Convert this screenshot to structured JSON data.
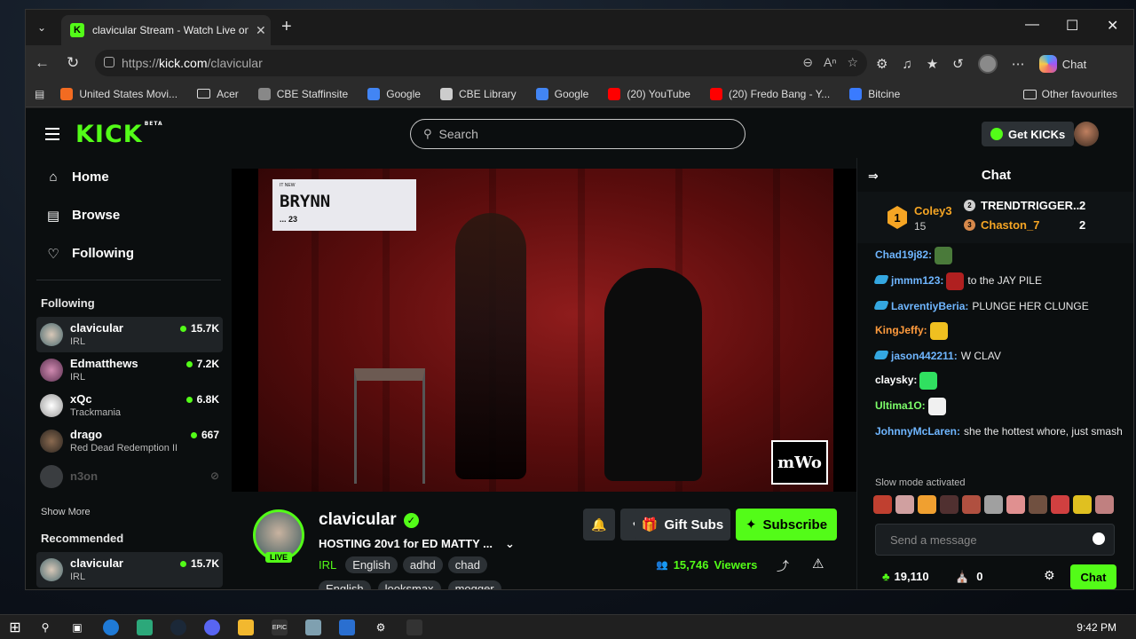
{
  "browser": {
    "tab_title": "clavicular Stream - Watch Live on",
    "url_scheme": "https://",
    "url_host": "kick.com",
    "url_path": "/clavicular",
    "copilot_label": "Chat",
    "bookmarks": [
      {
        "label": "United States Movi...",
        "color": "#f26b21"
      },
      {
        "label": "Acer",
        "color": "folder"
      },
      {
        "label": "CBE Staffinsite",
        "color": "#888888"
      },
      {
        "label": "Google",
        "color": "#4285f4"
      },
      {
        "label": "CBE Library",
        "color": "#cccccc"
      },
      {
        "label": "Google",
        "color": "#4285f4"
      },
      {
        "label": "(20) YouTube",
        "color": "#ff0000"
      },
      {
        "label": "(20) Fredo Bang - Y...",
        "color": "#ff0000"
      },
      {
        "label": "Bitcine",
        "color": "#3a7bff"
      }
    ],
    "other_favourites": "Other favourites"
  },
  "kick": {
    "logo": "KICK",
    "logo_sup": "BETA",
    "search_placeholder": "Search",
    "get_kicks": "Get KICKs",
    "accent": "#53fc18"
  },
  "sidebar": {
    "nav": [
      {
        "label": "Home",
        "icon": "home-icon"
      },
      {
        "label": "Browse",
        "icon": "browse-icon"
      },
      {
        "label": "Following",
        "icon": "heart-icon"
      }
    ],
    "following_title": "Following",
    "following": [
      {
        "name": "clavicular",
        "category": "IRL",
        "viewers": "15.7K"
      },
      {
        "name": "Edmatthews",
        "category": "IRL",
        "viewers": "7.2K"
      },
      {
        "name": "xQc",
        "category": "Trackmania",
        "viewers": "6.8K"
      },
      {
        "name": "drago",
        "category": "Red Dead Redemption II",
        "viewers": "667"
      }
    ],
    "offline_channel": "n3on",
    "show_more": "Show More",
    "recommended_title": "Recommended",
    "recommended": [
      {
        "name": "clavicular",
        "category": "IRL",
        "viewers": "15.7K"
      }
    ]
  },
  "video": {
    "name_card_small": "IT NEW",
    "name_card_name": "BRYNN",
    "name_card_age": "... 23",
    "watermark": "mWo"
  },
  "stream": {
    "streamer": "clavicular",
    "live_label": "LIVE",
    "title": "HOSTING 20v1 for ED MATTY ...",
    "category": "IRL",
    "tags_row1": [
      "English",
      "adhd",
      "chad"
    ],
    "tags_row2": [
      "English",
      "looksmax",
      "mogger"
    ],
    "gift_subs": "Gift Subs",
    "subscribe": "Subscribe",
    "viewers": "15,746",
    "viewers_label": "Viewers"
  },
  "chat": {
    "title": "Chat",
    "leaderboard": {
      "first": {
        "name": "Coley3",
        "count": "15",
        "rank": "1"
      },
      "second": {
        "name": "TRENDTRIGGER...",
        "count": "2",
        "rank": "2"
      },
      "third": {
        "name": "Chaston_7",
        "count": "2",
        "rank": "3"
      }
    },
    "messages": [
      {
        "user": "Chad19j82:",
        "color": "#6fb6ff",
        "text": "",
        "badge": false
      },
      {
        "user": "jmmm123:",
        "color": "#6fb6ff",
        "text": "to the JAY PILE",
        "badge": true
      },
      {
        "user": "LavrentiyBeria:",
        "color": "#6fb6ff",
        "text": "PLUNGE HER CLUNGE",
        "badge": true
      },
      {
        "user": "KingJeffy:",
        "color": "#ff9b3d",
        "text": "",
        "badge": false
      },
      {
        "user": "jason442211:",
        "color": "#6fb6ff",
        "text": "W CLAV",
        "badge": true
      },
      {
        "user": "claysky:",
        "color": "#ffffff",
        "text": "",
        "badge": false
      },
      {
        "user": "Ultima1O:",
        "color": "#7dff6a",
        "text": "",
        "badge": false
      },
      {
        "user": "JohnnyMcLaren:",
        "color": "#6fb6ff",
        "text": "she the hottest whore, just smash",
        "badge": false
      }
    ],
    "slow_mode": "Slow mode activated",
    "input_placeholder": "Send a message",
    "points": "19,110",
    "store_count": "0",
    "chat_button": "Chat"
  },
  "taskbar": {
    "clock": "9:42 PM"
  }
}
